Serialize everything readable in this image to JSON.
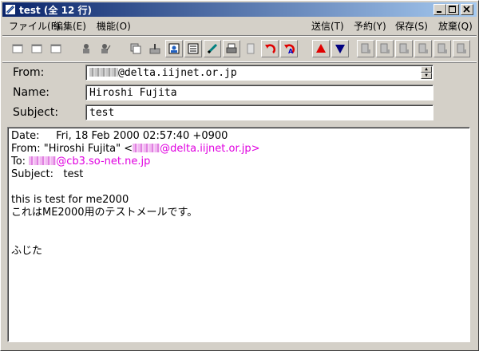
{
  "window": {
    "title": "test (全 12 行)"
  },
  "menubar": {
    "left": [
      "ファイル(F)",
      "編集(E)",
      "機能(O)"
    ],
    "right": [
      "送信(T)",
      "予約(Y)",
      "保存(S)",
      "放棄(Q)"
    ]
  },
  "header": {
    "from_label": "From:",
    "from_suffix": "@delta.iijnet.or.jp",
    "name_label": "Name:",
    "name_value": "Hiroshi Fujita",
    "subject_label": "Subject:",
    "subject_value": "test"
  },
  "body": {
    "date_line": "Date:     Fri, 18 Feb 2000 02:57:40 +0900",
    "from_prefix": "From: \"Hiroshi Fujita\" <",
    "from_domain": "@delta.iijnet.or.jp>",
    "to_prefix": "To: ",
    "to_domain": "@cb3.so-net.ne.jp",
    "subject_line": "Subject:   test",
    "text_line1": "this is test for me2000",
    "text_line2": "これはME2000用のテストメールです。",
    "signature": "ふじた"
  },
  "colors": {
    "titlebar_start": "#0a246a",
    "titlebar_end": "#a6caf0",
    "link_pink": "#e000e0"
  }
}
